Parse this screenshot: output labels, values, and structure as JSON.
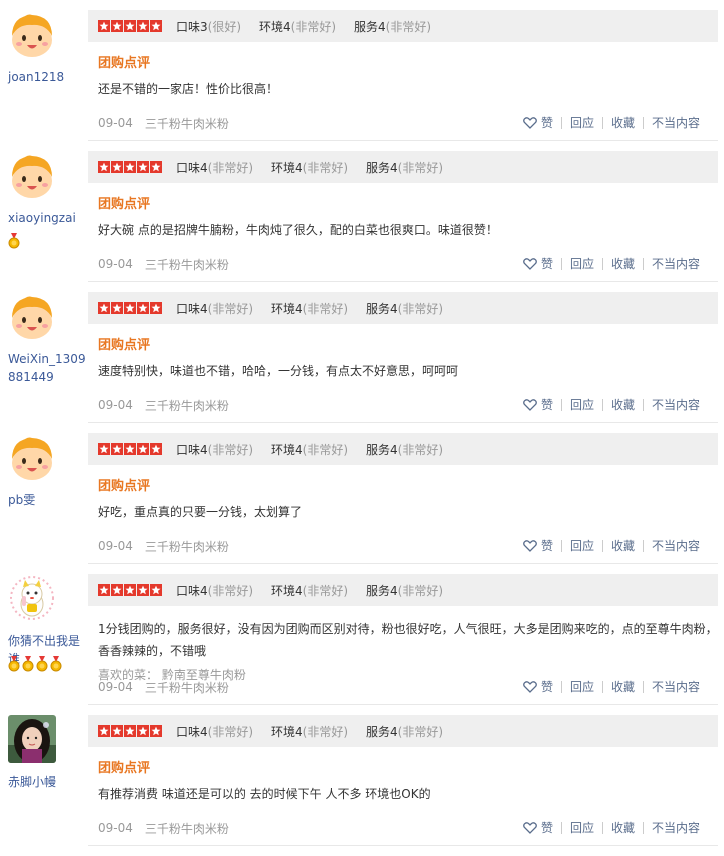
{
  "reviews": [
    {
      "user": "joan1218",
      "avatar": "cartoon-avatar-icon",
      "medals": 0,
      "scores": [
        {
          "label": "口味3",
          "quality": "(很好)"
        },
        {
          "label": "环境4",
          "quality": "(非常好)"
        },
        {
          "label": "服务4",
          "quality": "(非常好)"
        }
      ],
      "tag": "团购点评",
      "text": "还是不错的一家店！性价比很高！",
      "liked": "",
      "date": "09-04",
      "shop": "三千粉牛肉米粉"
    },
    {
      "user": "xiaoyingzai",
      "avatar": "cartoon-avatar-icon",
      "medals": 1,
      "scores": [
        {
          "label": "口味4",
          "quality": "(非常好)"
        },
        {
          "label": "环境4",
          "quality": "(非常好)"
        },
        {
          "label": "服务4",
          "quality": "(非常好)"
        }
      ],
      "tag": "团购点评",
      "text": "好大碗 点的是招牌牛腩粉，牛肉炖了很久，配的白菜也很爽口。味道很赞！",
      "liked": "",
      "date": "09-04",
      "shop": "三千粉牛肉米粉"
    },
    {
      "user": "WeiXin_1309881449",
      "avatar": "cartoon-avatar-icon",
      "medals": 0,
      "scores": [
        {
          "label": "口味4",
          "quality": "(非常好)"
        },
        {
          "label": "环境4",
          "quality": "(非常好)"
        },
        {
          "label": "服务4",
          "quality": "(非常好)"
        }
      ],
      "tag": "团购点评",
      "text": "速度特别快，味道也不错，哈哈，一分钱，有点太不好意思，呵呵呵",
      "liked": "",
      "date": "09-04",
      "shop": "三千粉牛肉米粉"
    },
    {
      "user": "pb雯",
      "avatar": "cartoon-avatar-icon",
      "medals": 0,
      "scores": [
        {
          "label": "口味4",
          "quality": "(非常好)"
        },
        {
          "label": "环境4",
          "quality": "(非常好)"
        },
        {
          "label": "服务4",
          "quality": "(非常好)"
        }
      ],
      "tag": "团购点评",
      "text": "好吃，重点真的只要一分钱，太划算了",
      "liked": "",
      "date": "09-04",
      "shop": "三千粉牛肉米粉"
    },
    {
      "user": "你猜不出我是谁",
      "avatar": "lucky-cat-avatar-icon",
      "medals": 4,
      "scores": [
        {
          "label": "口味4",
          "quality": "(非常好)"
        },
        {
          "label": "环境4",
          "quality": "(非常好)"
        },
        {
          "label": "服务4",
          "quality": "(非常好)"
        }
      ],
      "tag": "",
      "text": "1分钱团购的，服务很好，没有因为团购而区别对待，粉也很好吃，人气很旺，大多是团购来吃的，点的至尊牛肉粉，香香辣辣的，不错哦",
      "liked": "喜欢的菜：  黔南至尊牛肉粉",
      "date": "09-04",
      "shop": "三千粉牛肉米粉"
    },
    {
      "user": "赤脚小幔",
      "avatar": "photo-avatar-icon",
      "medals": 0,
      "scores": [
        {
          "label": "口味4",
          "quality": "(非常好)"
        },
        {
          "label": "环境4",
          "quality": "(非常好)"
        },
        {
          "label": "服务4",
          "quality": "(非常好)"
        }
      ],
      "tag": "团购点评",
      "text": "有推荐消费 味道还是可以的 去的时候下午 人不多 环境也OK的",
      "liked": "",
      "date": "09-04",
      "shop": "三千粉牛肉米粉"
    }
  ],
  "actions": {
    "like": "赞",
    "reply": "回应",
    "favorite": "收藏",
    "report": "不当内容"
  },
  "colors": {
    "star": "#e4392c",
    "tag": "#e87722",
    "link": "#5a6d8c",
    "username": "#3b5998"
  }
}
